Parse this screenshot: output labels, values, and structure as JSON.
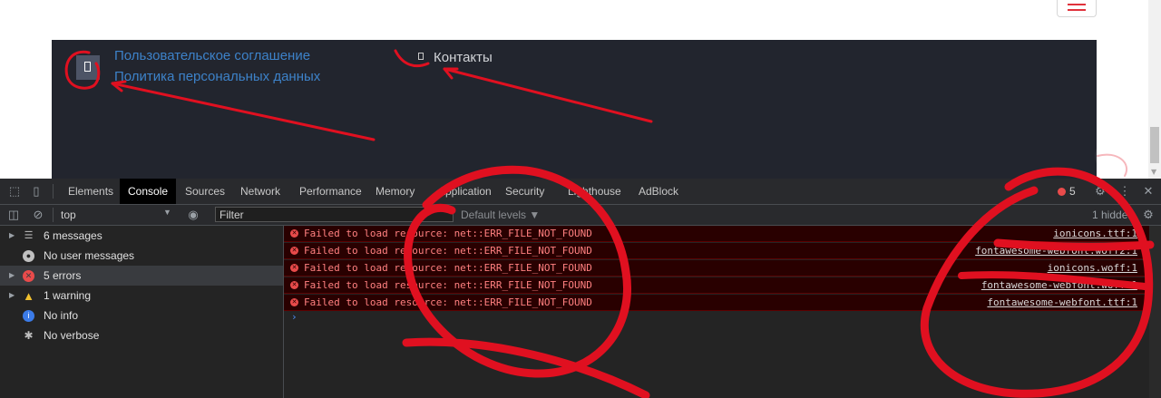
{
  "site": {
    "links": {
      "agreement": "Пользовательское соглашение",
      "privacy": "Политика персональных данных",
      "contacts": "Контакты"
    },
    "icons": {
      "menu": "hamburger-icon",
      "broken": "missing-glyph-icon",
      "to_top": "scroll-top-icon"
    },
    "colors": {
      "footer_bg": "#22252e",
      "link": "#3d82c9",
      "accent": "#e0323c"
    }
  },
  "devtools": {
    "tabs": [
      "Elements",
      "Console",
      "Sources",
      "Network",
      "Performance",
      "Memory",
      "Application",
      "Security",
      "Lighthouse",
      "AdBlock"
    ],
    "active_tab": "Console",
    "error_count": "5",
    "context": "top",
    "filter_placeholder": "Filter",
    "levels": "Default levels ▼",
    "hidden": "1 hidden",
    "sidebar": [
      {
        "label": "6 messages",
        "icon": "list-icon"
      },
      {
        "label": "No user messages",
        "icon": "user-icon"
      },
      {
        "label": "5 errors",
        "icon": "error-icon"
      },
      {
        "label": "1 warning",
        "icon": "warning-icon"
      },
      {
        "label": "No info",
        "icon": "info-icon"
      },
      {
        "label": "No verbose",
        "icon": "bug-icon"
      }
    ],
    "messages": [
      {
        "text": "Failed to load resource: net::ERR_FILE_NOT_FOUND",
        "source": "ionicons.ttf:1"
      },
      {
        "text": "Failed to load resource: net::ERR_FILE_NOT_FOUND",
        "source": "fontawesome-webfont.woff2:1"
      },
      {
        "text": "Failed to load resource: net::ERR_FILE_NOT_FOUND",
        "source": "ionicons.woff:1"
      },
      {
        "text": "Failed to load resource: net::ERR_FILE_NOT_FOUND",
        "source": "fontawesome-webfont.woff:1"
      },
      {
        "text": "Failed to load resource: net::ERR_FILE_NOT_FOUND",
        "source": "fontawesome-webfont.ttf:1"
      }
    ],
    "colors": {
      "error_bg": "#290000",
      "error_text": "#ff8080",
      "error_icon": "#e94b4b",
      "prompt": "#4e8ef7"
    }
  },
  "annotation": {
    "color": "#e01020"
  }
}
